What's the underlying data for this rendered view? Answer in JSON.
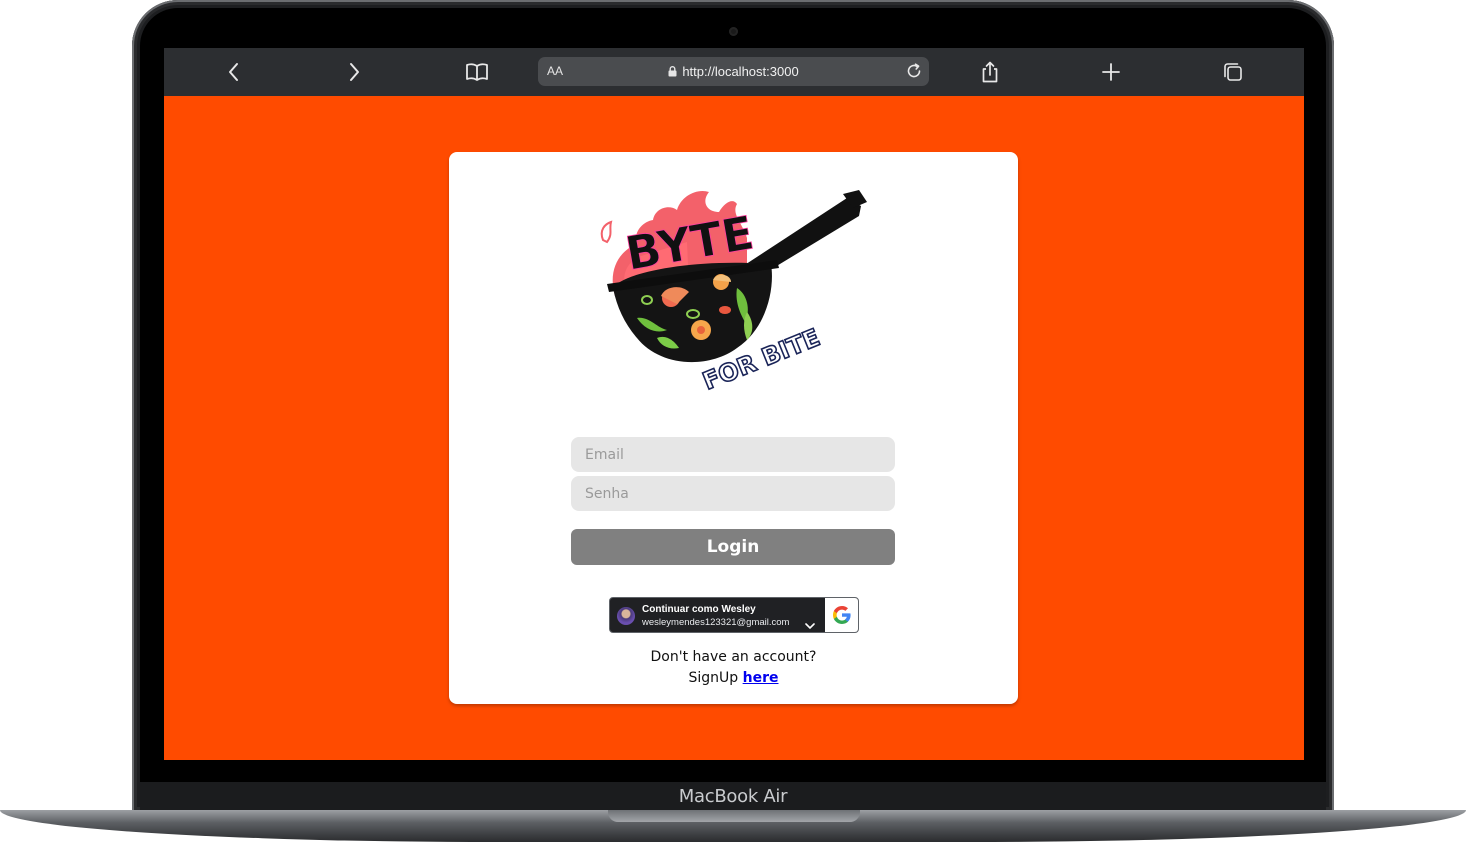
{
  "device": {
    "label": "MacBook Air"
  },
  "browser": {
    "reader_label": "AA",
    "url": "http://localhost:3000",
    "icons": [
      "back-icon",
      "forward-icon",
      "bookmarks-icon",
      "lock-icon",
      "reload-icon",
      "share-icon",
      "new-tab-icon",
      "tabs-icon"
    ]
  },
  "colors": {
    "page_background": "#ff4b00",
    "login_button": "#808080",
    "field_background": "#e6e6e6",
    "link": "#0000ee"
  },
  "logo": {
    "text_top": "BYTE",
    "text_bottom": "FOR BITE"
  },
  "form": {
    "email_placeholder": "Email",
    "password_placeholder": "Senha",
    "login_label": "Login"
  },
  "google": {
    "name_line": "Continuar como Wesley",
    "email_line": "wesleymendes123321@gmail.com"
  },
  "signup": {
    "question": "Don't have an account?",
    "prefix": "SignUp",
    "link_label": "here"
  }
}
